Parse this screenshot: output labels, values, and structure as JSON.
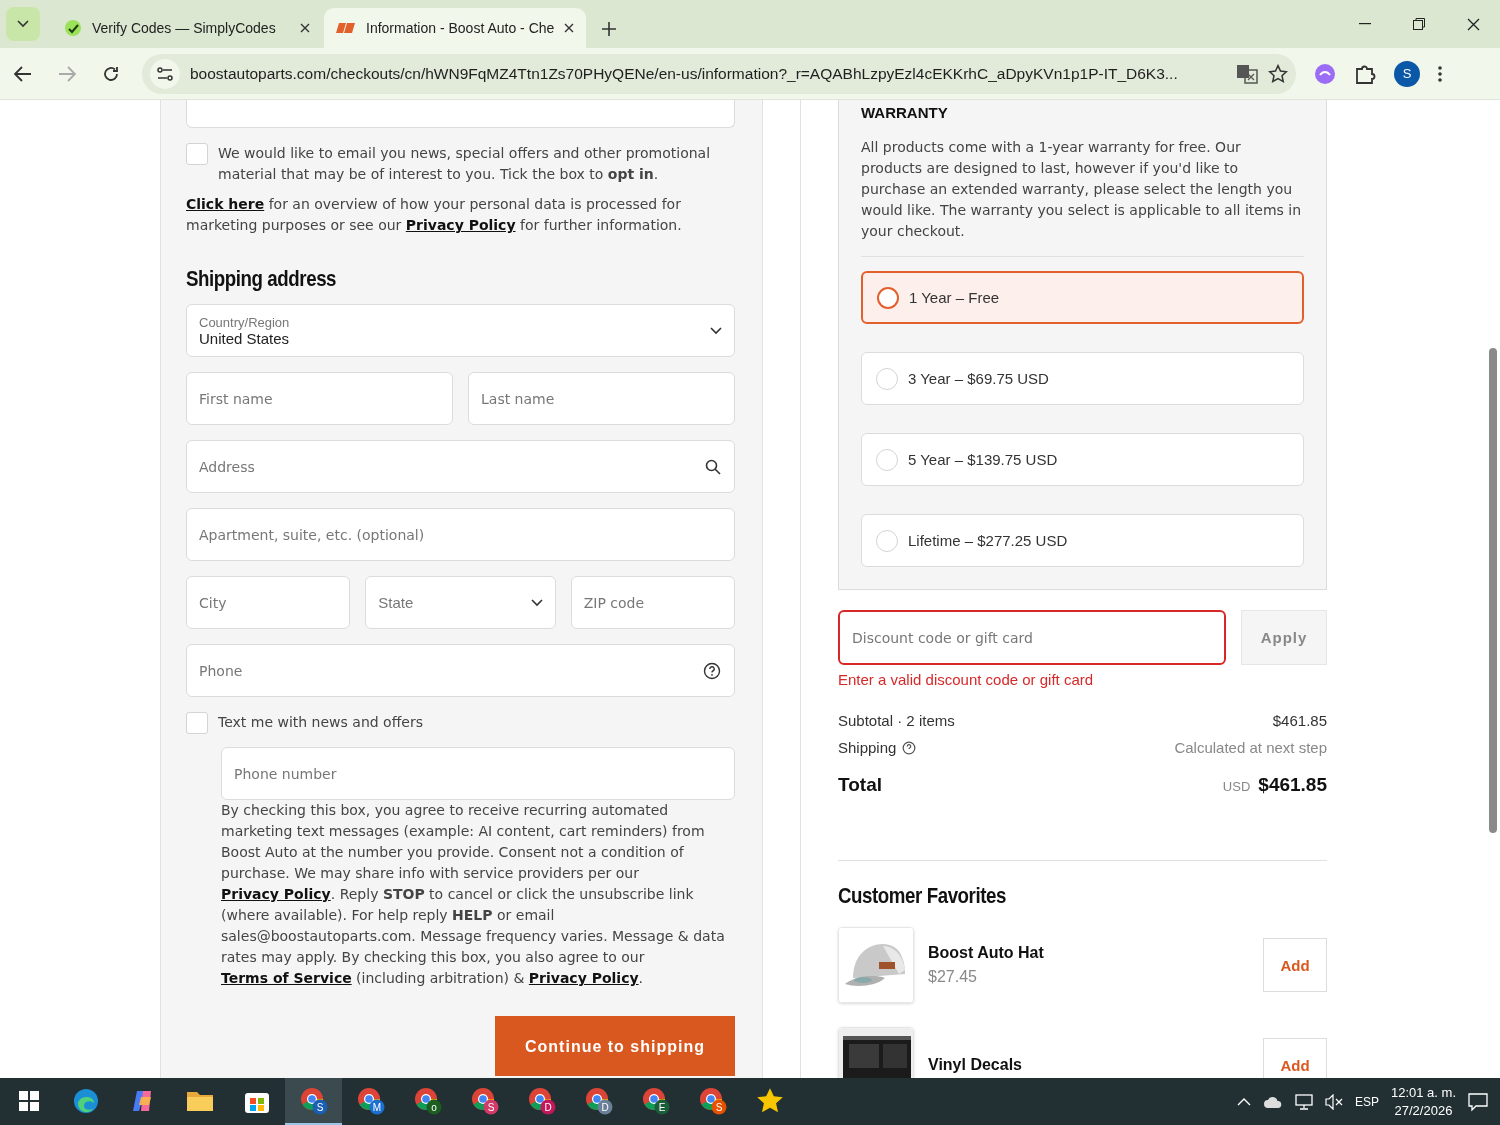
{
  "browser": {
    "tabs": [
      {
        "title": "Verify Codes — SimplyCodes",
        "selected": false
      },
      {
        "title": "Information - Boost Auto - Che",
        "selected": true
      }
    ],
    "url": "boostautoparts.com/checkouts/cn/hWN9FqMZ4Ttn1Zs70PHyQENe/en-us/information?_r=AQABhLzpyEzl4cEKKrhC_aDpyKVn1p1P-IT_D6K3...",
    "profile": "S"
  },
  "marketing_opt_in": {
    "checked": false,
    "text": "We would like to email you news, special offers and other promotional material that may be of interest to you. Tick the box to **opt in**."
  },
  "privacy_note": [
    {
      "kind": "link",
      "text": "Click here"
    },
    {
      "kind": "text",
      "text": " for an overview of how your personal data is processed for marketing purposes or see our "
    },
    {
      "kind": "link",
      "text": "Privacy Policy"
    },
    {
      "kind": "text",
      "text": " for further information."
    }
  ],
  "shipping": {
    "title": "Shipping address",
    "country": {
      "label": "Country/Region",
      "value": "United States"
    },
    "first_name": {
      "placeholder": "First name"
    },
    "last_name": {
      "placeholder": "Last name"
    },
    "address": {
      "placeholder": "Address"
    },
    "apartment": {
      "placeholder": "Apartment, suite, etc. (optional)"
    },
    "city": {
      "placeholder": "City"
    },
    "state": {
      "placeholder": "State"
    },
    "zip": {
      "placeholder": "ZIP code"
    },
    "phone": {
      "placeholder": "Phone"
    }
  },
  "sms_opt_in": {
    "checked": false,
    "label": "Text me with news and offers",
    "phone_placeholder": "Phone number",
    "consent": [
      {
        "kind": "text",
        "text": "By checking this box, you agree to receive recurring automated marketing text messages (example: AI content, cart reminders) from Boost Auto at the number you provide. Consent not a condition of purchase. We may share info with service providers per our "
      },
      {
        "kind": "link",
        "text": "Privacy Policy"
      },
      {
        "kind": "text",
        "text": ". Reply **STOP** to cancel or click the unsubscribe link (where available). For help reply **HELP** or email sales@boostautoparts.com. Message frequency varies. Message & data rates may apply. By checking this box, you also agree to our "
      },
      {
        "kind": "link",
        "text": "Terms of Service"
      },
      {
        "kind": "text",
        "text": " (including arbitration) & "
      },
      {
        "kind": "link",
        "text": "Privacy Policy"
      },
      {
        "kind": "text",
        "text": "."
      }
    ]
  },
  "continue_button": "Continue to shipping",
  "warranty": {
    "title": "WARRANTY",
    "description": "All products come with a 1-year warranty for free. Our products are designed to last, however if you'd like to purchase an extended warranty, please select the length you would like. The warranty you select is applicable to all items in your checkout.",
    "options": [
      {
        "label": "1 Year – Free",
        "selected": true
      },
      {
        "label": "3 Year – $69.75 USD",
        "selected": false
      },
      {
        "label": "5 Year – $139.75 USD",
        "selected": false
      },
      {
        "label": "Lifetime – $277.25 USD",
        "selected": false
      }
    ]
  },
  "discount": {
    "placeholder": "Discount code or gift card",
    "button": "Apply",
    "error": "Enter a valid discount code or gift card"
  },
  "summary": {
    "subtotal_label": "Subtotal · 2 items",
    "subtotal": "$461.85",
    "shipping_label": "Shipping",
    "shipping": "Calculated at next step",
    "total_label": "Total",
    "currency": "USD",
    "total": "$461.85"
  },
  "favorites": {
    "title": "Customer Favorites",
    "items": [
      {
        "name": "Boost Auto Hat",
        "price": "$27.45",
        "button": "Add",
        "kind": "hat"
      },
      {
        "name": "Vinyl Decals",
        "button": "Add",
        "kind": "decal"
      }
    ]
  },
  "taskbar": {
    "apps": [
      {
        "kind": "edge",
        "selected": false
      },
      {
        "kind": "copilot",
        "selected": false
      },
      {
        "kind": "files",
        "selected": false
      },
      {
        "kind": "store",
        "selected": false
      },
      {
        "kind": "chrome",
        "badge": "S",
        "color": "#1a5fb4",
        "selected": true
      },
      {
        "kind": "chrome",
        "badge": "M",
        "color": "#1a6fd1",
        "selected": false
      },
      {
        "kind": "chrome",
        "badge": "o",
        "color": "#1b5e20",
        "selected": false
      },
      {
        "kind": "chrome",
        "badge": "S",
        "color": "#d23a6a",
        "selected": false
      },
      {
        "kind": "chrome",
        "badge": "D",
        "color": "#c2185b",
        "selected": false
      },
      {
        "kind": "chrome",
        "badge": "D",
        "color": "#6b7f99",
        "selected": false
      },
      {
        "kind": "chrome",
        "badge": "E",
        "color": "#1b5e3a",
        "selected": false
      },
      {
        "kind": "chrome",
        "badge": "S",
        "color": "#e65100",
        "selected": false
      },
      {
        "kind": "star",
        "selected": false
      }
    ],
    "language": "ESP",
    "time": "12:01 a. m.",
    "date": "27/2/2026"
  }
}
